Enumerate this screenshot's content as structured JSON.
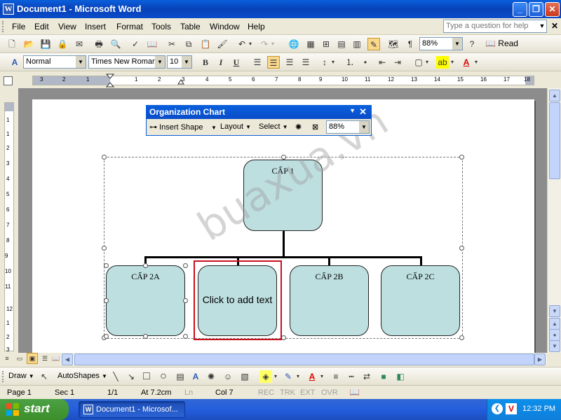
{
  "window": {
    "title": "Document1 - Microsoft Word",
    "app_icon_letter": "W",
    "min_label": "_",
    "max_label": "❐",
    "close_label": "✕"
  },
  "menus": [
    "File",
    "Edit",
    "View",
    "Insert",
    "Format",
    "Tools",
    "Table",
    "Window",
    "Help"
  ],
  "ask_question": {
    "placeholder": "Type a question for help"
  },
  "doc_close": "✕",
  "standard_toolbar": {
    "zoom": "88%",
    "read_label": "Read"
  },
  "formatting_toolbar": {
    "style": "Normal",
    "font": "Times New Roman",
    "size": "10",
    "bold": "B",
    "italic": "I",
    "underline": "U"
  },
  "ruler": {
    "marks": [
      "3",
      "2",
      "1",
      "1",
      "2",
      "3",
      "4",
      "5",
      "6",
      "7",
      "8",
      "9",
      "10",
      "11",
      "12",
      "13",
      "14",
      "15",
      "16",
      "17",
      "18"
    ],
    "vmarks": [
      "1",
      "1",
      "2",
      "3",
      "4",
      "5",
      "6",
      "7",
      "8",
      "9",
      "10",
      "11",
      "12",
      "1",
      "2",
      "3"
    ]
  },
  "org_toolbar": {
    "title": "Organization Chart",
    "insert_shape": "Insert Shape",
    "layout": "Layout",
    "select": "Select",
    "zoom": "88%"
  },
  "org_chart": {
    "top": "CẤP 1",
    "children": [
      "CẤP 2A",
      "Click to add text",
      "CẤP 2B",
      "CẤP 2C"
    ]
  },
  "watermark": "buaxua.vn",
  "draw_toolbar": {
    "draw": "Draw",
    "autoshapes": "AutoShapes"
  },
  "status": {
    "page": "Page  1",
    "sec": "Sec  1",
    "pages": "1/1",
    "at": "At  7.2cm",
    "ln": "Ln",
    "col": "Col  7",
    "rec": "REC",
    "trk": "TRK",
    "ext": "EXT",
    "ovr": "OVR"
  },
  "taskbar": {
    "start": "start",
    "task": "Document1 - Microsof...",
    "time": "12:32 PM"
  }
}
